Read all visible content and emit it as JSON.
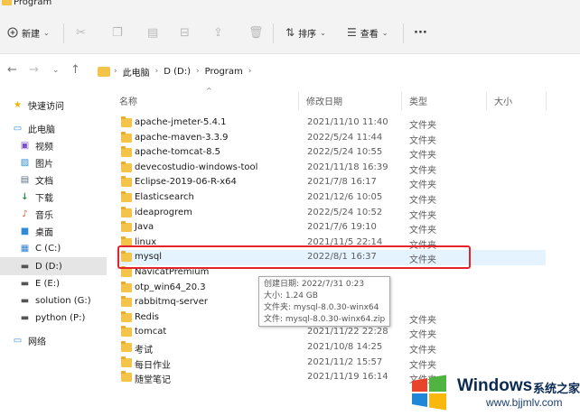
{
  "window": {
    "title": "Program"
  },
  "toolbar": {
    "new_label": "新建",
    "sort_label": "排序",
    "view_label": "查看",
    "more_label": "···"
  },
  "address": {
    "crumbs": [
      "此电脑",
      "D (D:)",
      "Program"
    ]
  },
  "sidebar": {
    "items": [
      {
        "label": "快速访问",
        "icon": "star-icon"
      },
      {
        "label": "此电脑",
        "icon": "computer-icon"
      },
      {
        "label": "视频",
        "icon": "video-icon"
      },
      {
        "label": "图片",
        "icon": "pictures-icon"
      },
      {
        "label": "文档",
        "icon": "documents-icon"
      },
      {
        "label": "下载",
        "icon": "download-icon"
      },
      {
        "label": "音乐",
        "icon": "music-icon"
      },
      {
        "label": "桌面",
        "icon": "desktop-icon"
      },
      {
        "label": "C (C:)",
        "icon": "drive-icon"
      },
      {
        "label": "D (D:)",
        "icon": "drive-icon"
      },
      {
        "label": "E (E:)",
        "icon": "drive-icon"
      },
      {
        "label": "solution (G:)",
        "icon": "drive-icon"
      },
      {
        "label": "python (P:)",
        "icon": "drive-icon"
      },
      {
        "label": "网络",
        "icon": "network-icon"
      }
    ]
  },
  "columns": {
    "name": "名称",
    "date": "修改日期",
    "type": "类型",
    "size": "大小"
  },
  "files": [
    {
      "name": "apache-jmeter-5.4.1",
      "date": "2021/11/10 11:40",
      "type": "文件夹"
    },
    {
      "name": "apache-maven-3.3.9",
      "date": "2022/5/24 11:44",
      "type": "文件夹"
    },
    {
      "name": "apache-tomcat-8.5",
      "date": "2022/5/24 10:55",
      "type": "文件夹"
    },
    {
      "name": "devecostudio-windows-tool",
      "date": "2021/11/18 16:39",
      "type": "文件夹"
    },
    {
      "name": "Eclipse-2019-06-R-x64",
      "date": "2021/7/8 16:17",
      "type": "文件夹"
    },
    {
      "name": "Elasticsearch",
      "date": "2021/12/6 10:05",
      "type": "文件夹"
    },
    {
      "name": "ideaprogrem",
      "date": "2022/5/24 10:52",
      "type": "文件夹"
    },
    {
      "name": "Java",
      "date": "2021/7/6 19:10",
      "type": "文件夹"
    },
    {
      "name": "linux",
      "date": "2021/11/5 22:14",
      "type": "文件夹"
    },
    {
      "name": "mysql",
      "date": "2022/8/1 16:37",
      "type": "文件夹"
    },
    {
      "name": "NavicatPremium",
      "date": "",
      "type": ""
    },
    {
      "name": "otp_win64_20.3",
      "date": "",
      "type": ""
    },
    {
      "name": "rabbitmq-server",
      "date": "",
      "type": ""
    },
    {
      "name": "Redis",
      "date": "",
      "type": "文件夹"
    },
    {
      "name": "tomcat",
      "date": "2021/11/22 22:28",
      "type": "文件夹"
    },
    {
      "name": "考试",
      "date": "2021/10/8 14:25",
      "type": "文件夹"
    },
    {
      "name": "每日作业",
      "date": "2021/11/2 15:57",
      "type": "文件夹"
    },
    {
      "name": "随堂笔记",
      "date": "2021/11/19 16:14",
      "type": "文件夹"
    }
  ],
  "tooltip": {
    "created": "创建日期: 2022/7/31 0:23",
    "size": "大小: 1.24 GB",
    "folders": "文件夹: mysql-8.0.30-winx64",
    "files": "文件: mysql-8.0.30-winx64.zip"
  },
  "watermark": {
    "brand": "Windows",
    "cn": "系统之家",
    "url": "www.bjjmlv.com"
  },
  "colors": {
    "highlight": "#e3252b",
    "hover": "#e5f3ff",
    "folder": "#f4c34a"
  }
}
